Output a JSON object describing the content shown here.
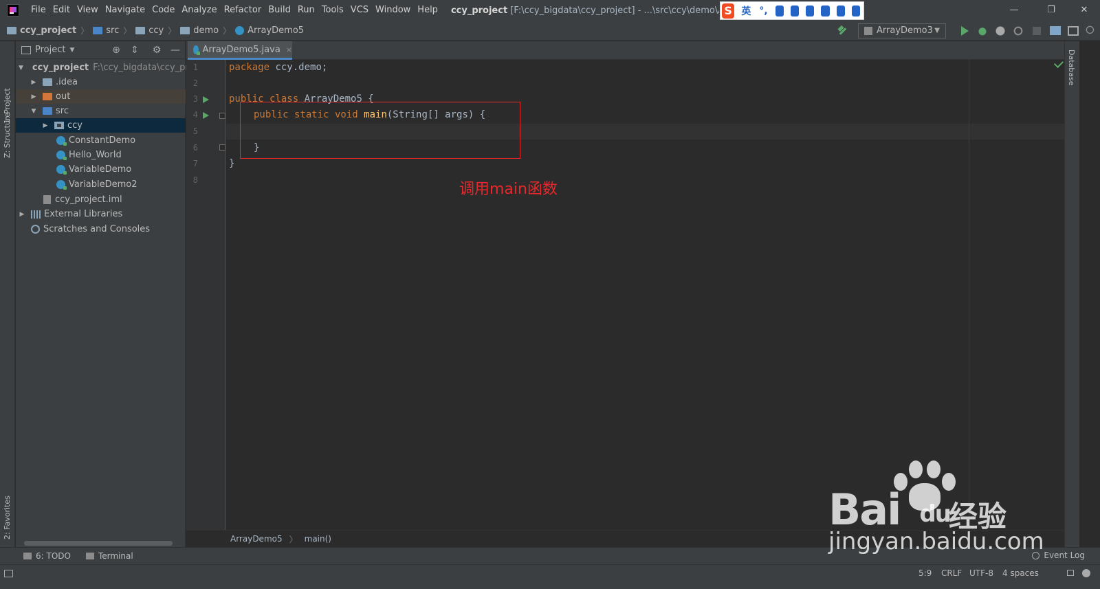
{
  "menu": {
    "items": [
      "File",
      "Edit",
      "View",
      "Navigate",
      "Code",
      "Analyze",
      "Refactor",
      "Build",
      "Run",
      "Tools",
      "VCS",
      "Window",
      "Help"
    ],
    "window_title_bold": "ccy_project",
    "window_title_rest": "[F:\\ccy_bigdata\\ccy_project] - ...\\src\\ccy\\demo\\Arr"
  },
  "ime": {
    "logo": "S",
    "lang": "英",
    "punct": "°,"
  },
  "window_controls": {
    "minimize": "—",
    "restore": "❐",
    "close": "✕"
  },
  "breadcrumbs": [
    "ccy_project",
    "src",
    "ccy",
    "demo",
    "ArrayDemo5"
  ],
  "toolbar": {
    "run_config": "ArrayDemo3"
  },
  "left_tabs": {
    "project": "1: Project",
    "structure": "Z: Structure",
    "favorites": "2: Favorites"
  },
  "right_tabs": {
    "database": "Database"
  },
  "project_panel": {
    "title": "Project",
    "tree": [
      {
        "label": "ccy_project",
        "path": "F:\\ccy_bigdata\\ccy_pro",
        "icon": "folder-icon",
        "expanded": true
      },
      {
        "label": ".idea",
        "icon": "folder-icon"
      },
      {
        "label": "out",
        "icon": "folder-orange-icon"
      },
      {
        "label": "src",
        "icon": "folder-blue-icon",
        "expanded": true
      },
      {
        "label": "ccy",
        "icon": "package-icon",
        "selected": true
      },
      {
        "label": "ConstantDemo",
        "icon": "class-icon"
      },
      {
        "label": "Hello_World",
        "icon": "class-icon"
      },
      {
        "label": "VariableDemo",
        "icon": "class-icon"
      },
      {
        "label": "VariableDemo2",
        "icon": "class-icon"
      },
      {
        "label": "ccy_project.iml",
        "icon": "iml-file-icon"
      },
      {
        "label": "External Libraries",
        "icon": "library-icon"
      },
      {
        "label": "Scratches and Consoles",
        "icon": "scratch-icon"
      }
    ]
  },
  "editor": {
    "tab": "ArrayDemo5.java",
    "tab_close": "×",
    "line_numbers": [
      "1",
      "2",
      "3",
      "4",
      "5",
      "6",
      "7",
      "8"
    ],
    "code": {
      "l1_kw": "package",
      "l1_rest": " ccy.demo;",
      "l3_kw": "public class",
      "l3_rest": " ArrayDemo5 {",
      "l4_kw": "public static void",
      "l4_fn": "main",
      "l4_rest": "(String[] args) {",
      "l6": "}",
      "l7": "}"
    },
    "annotation": "调用main函数",
    "annotation_color": "#e8282b",
    "crumbs": [
      "ArrayDemo5",
      "main()"
    ]
  },
  "bottom_tools": {
    "todo": "6: TODO",
    "terminal": "Terminal",
    "event_log": "Event Log"
  },
  "status": {
    "position": "5:9",
    "line_sep": "CRLF",
    "encoding": "UTF-8",
    "indent": "4 spaces"
  },
  "watermark": {
    "brand": "Bai",
    "du": "du",
    "jingyan": "经验",
    "domain": "jingyan.baidu.com"
  },
  "colors": {
    "keyword": "#cc7832",
    "function": "#ffc66d",
    "text": "#a9b7c6",
    "selection": "#0d293e"
  }
}
